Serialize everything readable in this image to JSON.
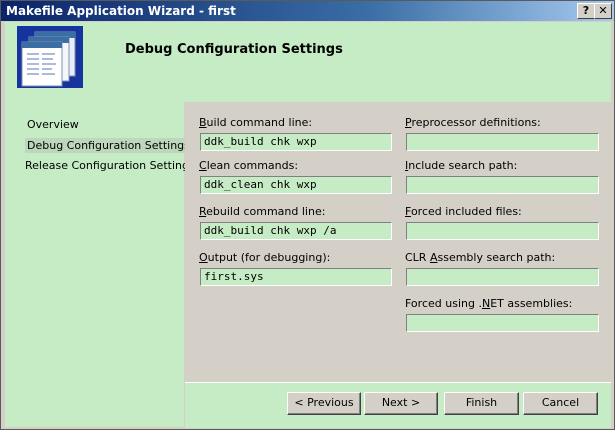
{
  "window": {
    "title": "Makefile Application Wizard - first",
    "help_button": "?",
    "close_button": "✕"
  },
  "header": {
    "title": "Debug Configuration Settings"
  },
  "nav": {
    "items": [
      {
        "label": "Overview"
      },
      {
        "label": "Debug Configuration Settings",
        "selected": true
      },
      {
        "label": "Release Configuration Settings"
      }
    ]
  },
  "left_fields": [
    {
      "label_pre": "",
      "label_acc": "B",
      "label_post": "uild command line:",
      "value": "ddk_build chk wxp"
    },
    {
      "label_pre": "",
      "label_acc": "C",
      "label_post": "lean commands:",
      "value": "ddk_clean chk wxp"
    },
    {
      "label_pre": "",
      "label_acc": "R",
      "label_post": "ebuild command line:",
      "value": "ddk_build chk wxp /a"
    },
    {
      "label_pre": "",
      "label_acc": "O",
      "label_post": "utput (for debugging):",
      "value": "first.sys"
    }
  ],
  "right_fields": [
    {
      "label_pre": "",
      "label_acc": "P",
      "label_post": "reprocessor definitions:",
      "value": ""
    },
    {
      "label_pre": "",
      "label_acc": "I",
      "label_post": "nclude search path:",
      "value": ""
    },
    {
      "label_pre": "",
      "label_acc": "F",
      "label_post": "orced included files:",
      "value": ""
    },
    {
      "label_pre": "CLR ",
      "label_acc": "A",
      "label_post": "ssembly search path:",
      "value": ""
    },
    {
      "label_pre": "Forced using .",
      "label_acc": "N",
      "label_post": "ET assemblies:",
      "value": ""
    }
  ],
  "buttons": {
    "previous": "< Previous",
    "next": "Next >",
    "finish": "Finish",
    "cancel": "Cancel"
  },
  "colors": {
    "accent_green": "#c6ecc6",
    "title_bar": "#0a246a"
  }
}
